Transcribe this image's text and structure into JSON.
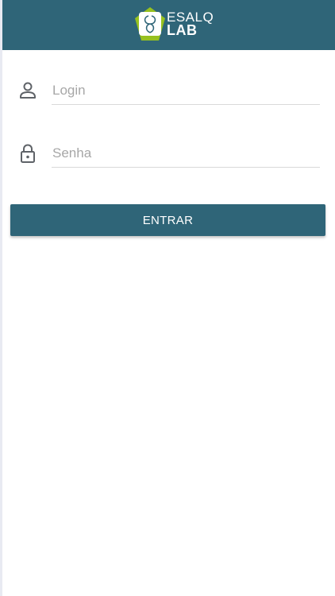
{
  "header": {
    "logo_line1": "ESALQ",
    "logo_line2": "LAB",
    "background_color": "#2f6578",
    "logo_icon": "esalq-lab-logo-icon"
  },
  "form": {
    "login": {
      "placeholder": "Login",
      "value": "",
      "icon": "user-icon"
    },
    "password": {
      "placeholder": "Senha",
      "value": "",
      "icon": "lock-icon"
    },
    "submit_label": "ENTRAR",
    "button_color": "#2f6578"
  }
}
